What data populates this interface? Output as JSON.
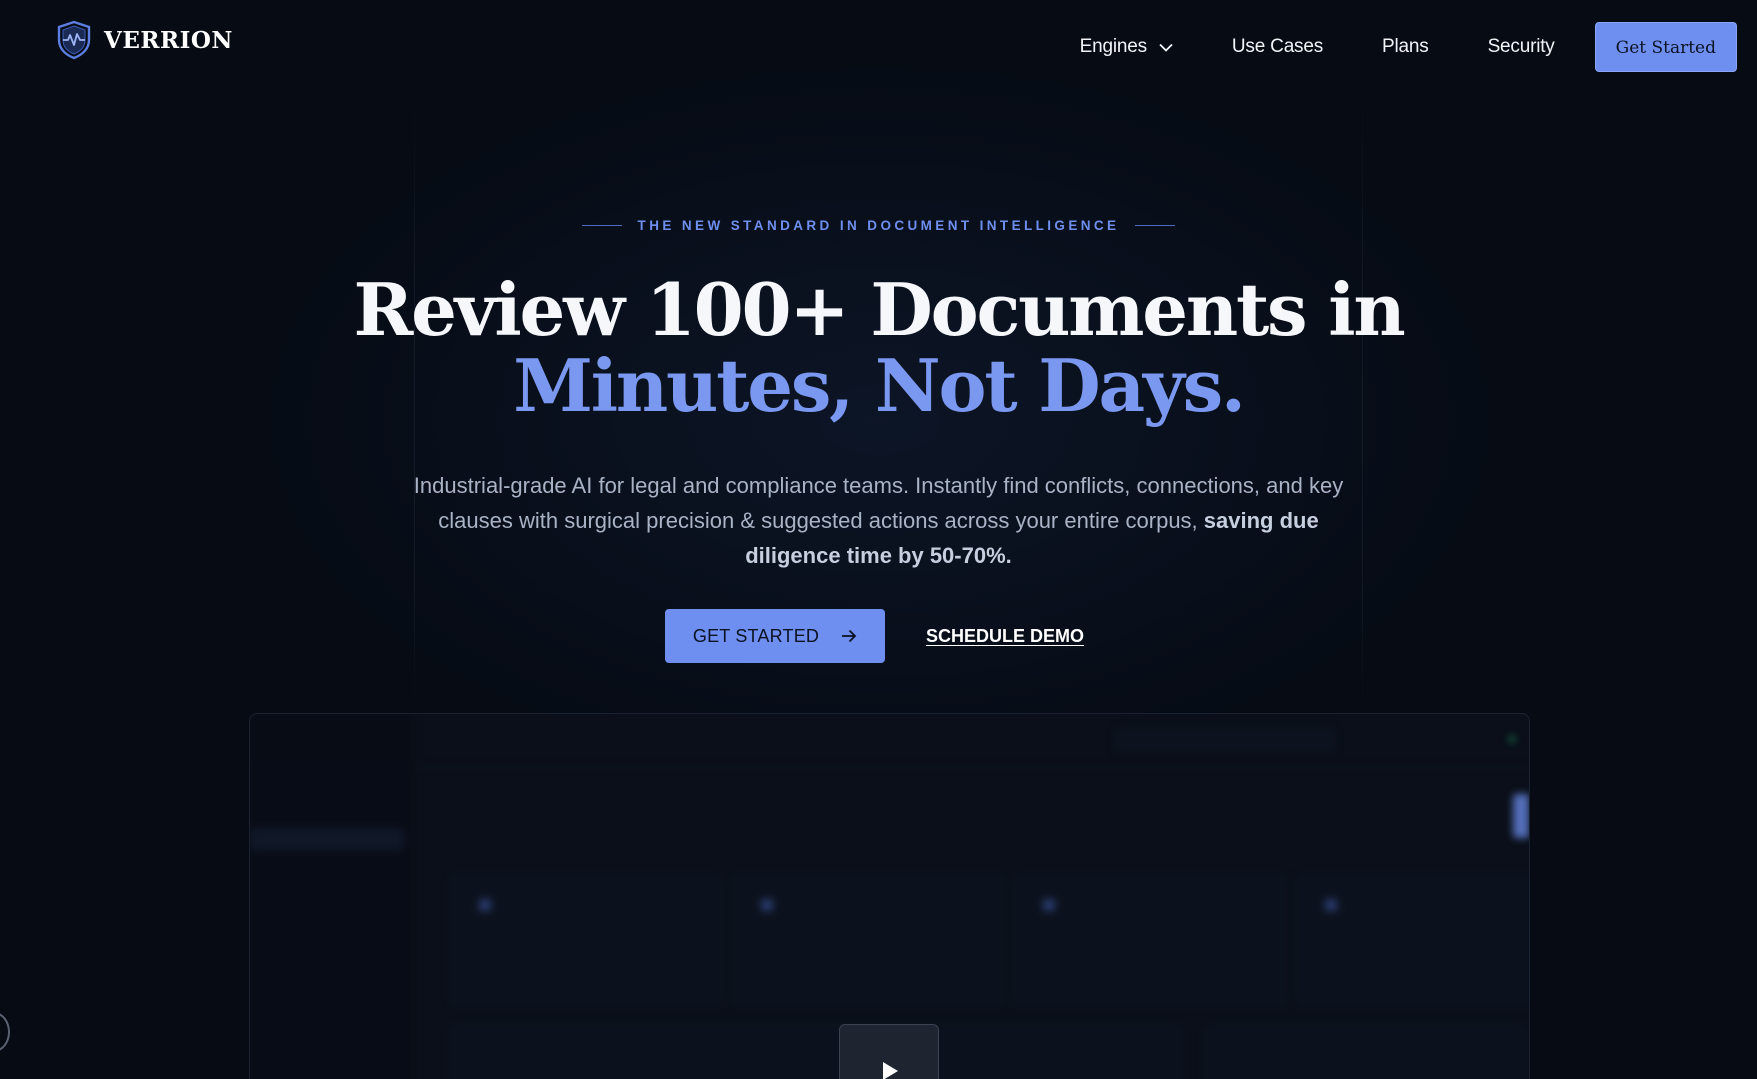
{
  "brand": {
    "name": "VERRION",
    "logo_icon": "shield-heartbeat-icon"
  },
  "nav": {
    "items": [
      {
        "label": "Engines",
        "has_dropdown": true
      },
      {
        "label": "Use Cases"
      },
      {
        "label": "Plans"
      },
      {
        "label": "Security"
      }
    ],
    "cta_label": "Get Started"
  },
  "hero": {
    "eyebrow": "THE NEW STANDARD IN DOCUMENT INTELLIGENCE",
    "headline_line1": "Review 100+ Documents in",
    "headline_line2": "Minutes, Not Days.",
    "subcopy_main": "Industrial-grade AI for legal and compliance teams. Instantly find conflicts, connections, and key clauses with surgical precision & suggested actions across your entire corpus, ",
    "subcopy_bold": "saving due diligence time by 50-70%.",
    "primary_cta": "GET STARTED",
    "primary_cta_icon": "arrow-right-icon",
    "secondary_cta": "SCHEDULE DEMO"
  },
  "colors": {
    "background": "#060b14",
    "accent": "#6e8ff0",
    "headline_accent": "#7b98f1",
    "text_muted": "#a9b3c6"
  }
}
